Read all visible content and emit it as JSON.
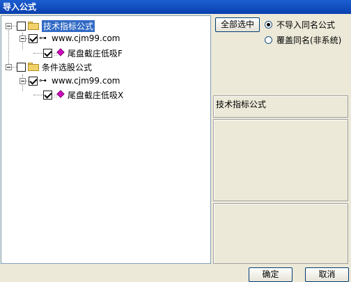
{
  "window": {
    "title": "导入公式"
  },
  "tree": {
    "nodes": [
      {
        "label": "技术指标公式",
        "checked": false,
        "selected": true
      },
      {
        "label": "www.cjm99.com",
        "checked": true
      },
      {
        "label": "尾盘截庄低吸F",
        "checked": true
      },
      {
        "label": "条件选股公式",
        "checked": false
      },
      {
        "label": "www.cjm99.com",
        "checked": true
      },
      {
        "label": "尾盘截庄低吸X",
        "checked": true
      }
    ]
  },
  "options": {
    "select_all_label": "全部选中",
    "radio_no_import": "不导入同名公式",
    "radio_overwrite": "覆盖同名(非系统)",
    "selected_radio": "no_import"
  },
  "info": {
    "category_text": "技术指标公式"
  },
  "footer": {
    "ok_label": "确定",
    "cancel_label": "取消"
  },
  "colors": {
    "titlebar": "#0a3fae",
    "selection": "#316ac5",
    "gem": "#d10bbf"
  }
}
